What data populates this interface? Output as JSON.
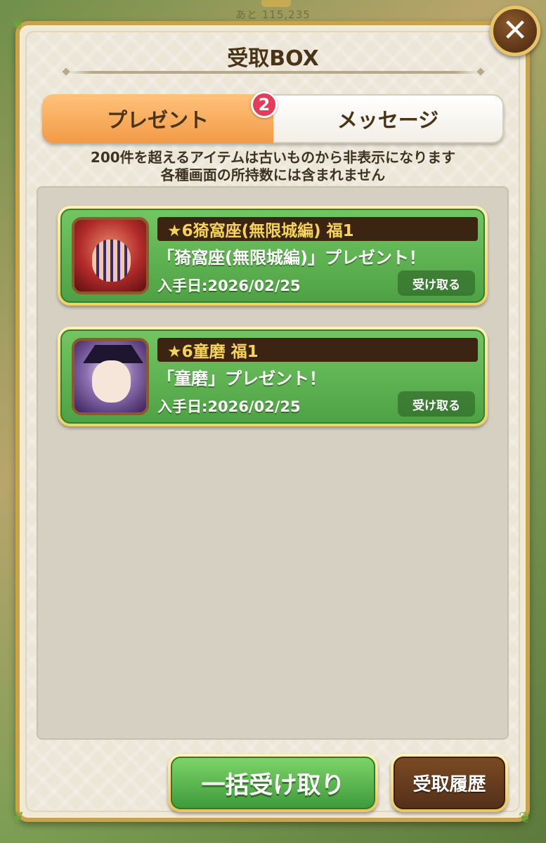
{
  "background": {
    "top_text": "あと 115,235"
  },
  "dialog": {
    "title": "受取BOX",
    "close_icon": "close-icon"
  },
  "tabs": [
    {
      "label": "プレゼント",
      "active": true
    },
    {
      "label": "メッセージ",
      "active": false
    }
  ],
  "badge": {
    "count": "2"
  },
  "notice": {
    "line1": "200件を超えるアイテムは古いものから非表示になります",
    "line2": "各種画面の所持数には含まれません"
  },
  "items": [
    {
      "title": "★6猗窩座(無限城編) 福1",
      "description": "「猗窩座(無限城編)」プレゼント！",
      "date": "入手日:2026/02/25",
      "button": "受け取る"
    },
    {
      "title": "★6童磨 福1",
      "description": "「童磨」プレゼント！",
      "date": "入手日:2026/02/25",
      "button": "受け取る"
    }
  ],
  "footer": {
    "bulk_receive": "一括受け取り",
    "history": "受取履歴"
  },
  "colors": {
    "tab_active": "#f29a47",
    "card_green": "#4ea244",
    "badge_red": "#e43b58",
    "title_brown": "#3b2412",
    "title_gold": "#f6d35a"
  }
}
